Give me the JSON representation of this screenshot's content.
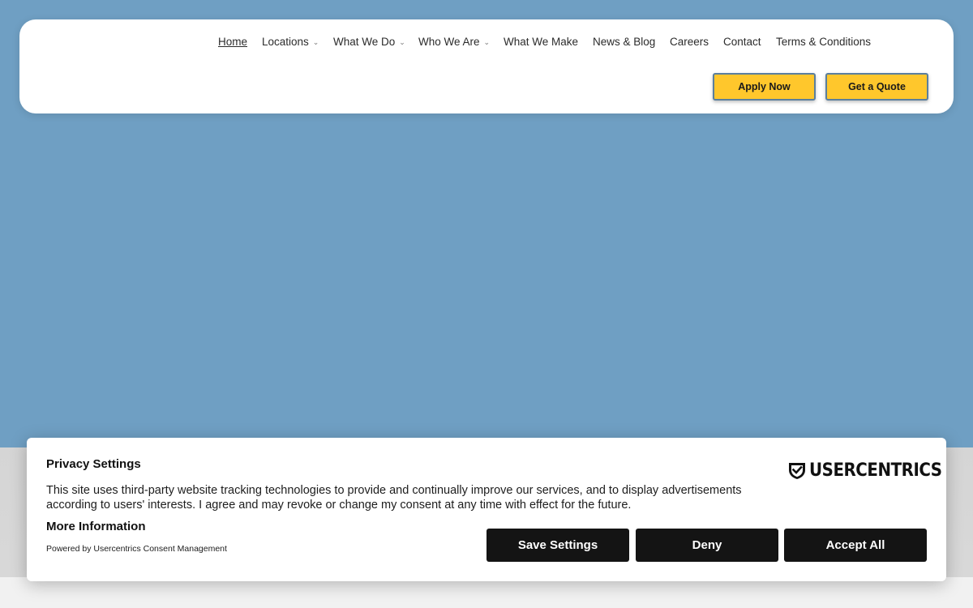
{
  "nav": {
    "items": [
      {
        "label": "Home",
        "active": true,
        "dropdown": false
      },
      {
        "label": "Locations",
        "active": false,
        "dropdown": true
      },
      {
        "label": "What We Do",
        "active": false,
        "dropdown": true
      },
      {
        "label": "Who We Are",
        "active": false,
        "dropdown": true
      },
      {
        "label": "What We Make",
        "active": false,
        "dropdown": false
      },
      {
        "label": "News & Blog",
        "active": false,
        "dropdown": false
      },
      {
        "label": "Careers",
        "active": false,
        "dropdown": false
      },
      {
        "label": "Contact",
        "active": false,
        "dropdown": false
      },
      {
        "label": "Terms & Conditions",
        "active": false,
        "dropdown": false
      }
    ],
    "chevron": "⌄"
  },
  "cta": {
    "apply_label": "Apply Now",
    "quote_label": "Get a Quote",
    "color": "#ffc72c"
  },
  "consent": {
    "title": "Privacy Settings",
    "text": "This site uses third-party website tracking technologies to provide and continually improve our services, and to display advertisements according to users' interests. I agree and may revoke or change my consent at any time with effect for the future.",
    "more_info": "More Information",
    "powered_by": "Powered by Usercentrics Consent Management",
    "brand": "USERCENTRICS",
    "buttons": {
      "save": "Save Settings",
      "deny": "Deny",
      "accept": "Accept All"
    }
  },
  "colors": {
    "hero_bg": "#6f9fc3",
    "button_dark": "#141414"
  }
}
